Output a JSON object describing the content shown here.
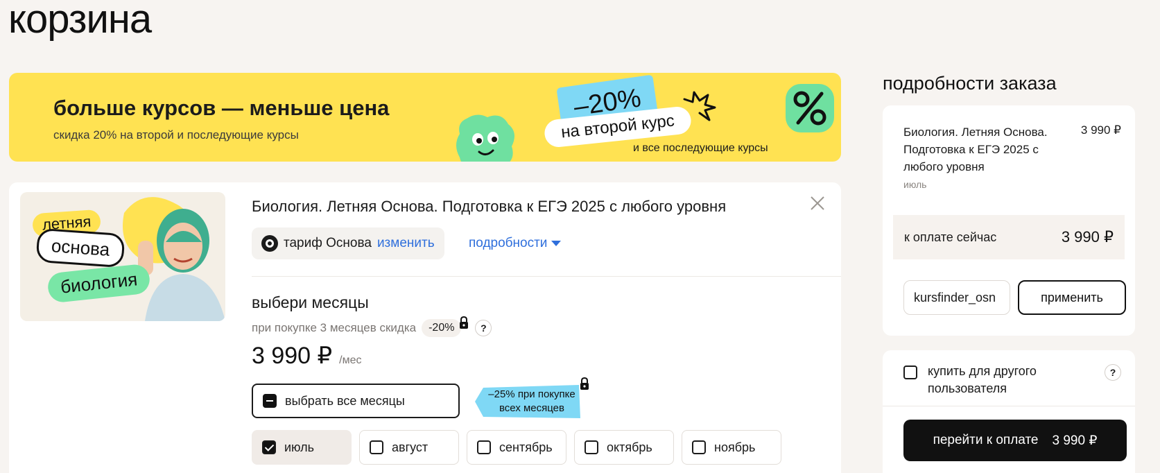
{
  "page": {
    "title": "корзина"
  },
  "banner": {
    "title": "больше курсов — меньше цена",
    "subtitle": "скидка 20% на второй и последующие курсы",
    "discount": "–20%",
    "second_course": "на второй курс",
    "all_next": "и все последующие курсы",
    "colors": {
      "background": "#ffe252",
      "tag": "#7fd8f5",
      "blob": "#6fe0a0"
    }
  },
  "course": {
    "title": "Биология. Летняя Основа. Подготовка к ЕГЭ 2025 с любого уровня",
    "image_tags": {
      "season": "летняя",
      "type": "основа",
      "subject": "биология"
    },
    "tariff_label": "тариф Основа",
    "change_link": "изменить",
    "details_link": "подробности",
    "months_heading": "выбери месяцы",
    "months_sub": "при покупке 3 месяцев скидка",
    "months_discount": "-20%",
    "help": "?",
    "price": "3 990 ₽",
    "price_unit": "/мес",
    "select_all": "выбрать все месяцы",
    "promo_line1": "–25% при покупке",
    "promo_line2": "всех месяцев",
    "months": [
      {
        "label": "июль",
        "checked": true
      },
      {
        "label": "август",
        "checked": false
      },
      {
        "label": "сентябрь",
        "checked": false
      },
      {
        "label": "октябрь",
        "checked": false
      },
      {
        "label": "ноябрь",
        "checked": false
      }
    ]
  },
  "order": {
    "title": "подробности заказа",
    "item_name": "Биология. Летняя Основа. Подготовка к ЕГЭ 2025 с любого уровня",
    "item_month": "июль",
    "item_price": "3 990 ₽",
    "pay_now_label": "к оплате сейчас",
    "pay_now_amount": "3 990 ₽",
    "promo_value": "kursfinder_osn",
    "apply_label": "применить",
    "gift_label": "купить для другого пользователя",
    "help": "?",
    "checkout_label": "перейти к оплате",
    "checkout_amount": "3 990 ₽"
  }
}
